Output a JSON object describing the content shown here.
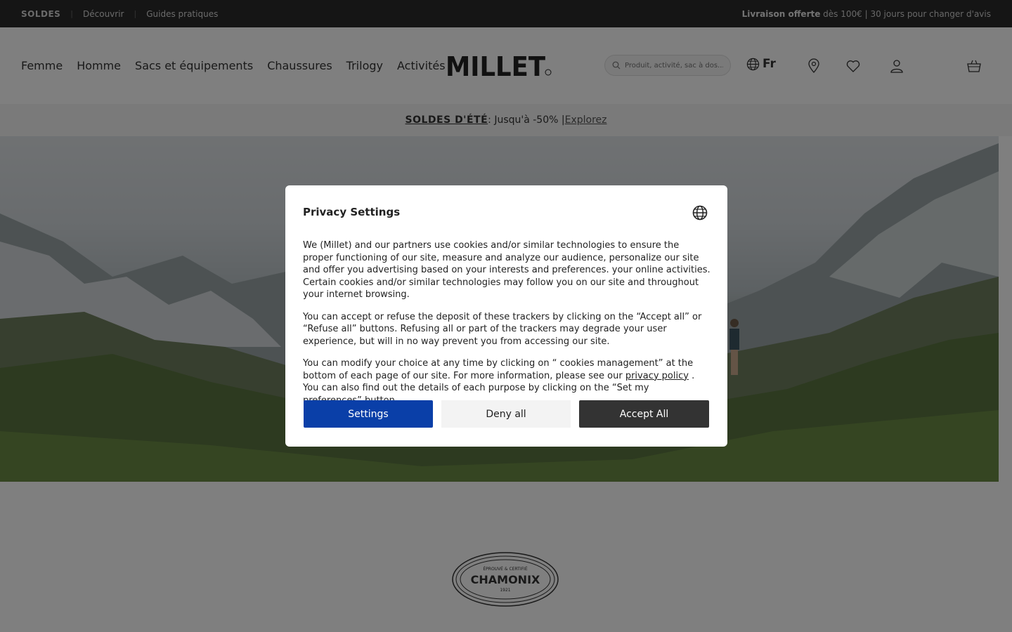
{
  "topbar": {
    "items": [
      "SOLDES",
      "Découvrir",
      "Guides pratiques"
    ],
    "shipping_bold": "Livraison offerte",
    "shipping_rest": " dès 100€ | 30 jours pour changer d'avis"
  },
  "nav": {
    "items": [
      "Femme",
      "Homme",
      "Sacs et équipements",
      "Chaussures",
      "Trilogy",
      "Activités"
    ]
  },
  "logo": {
    "text": "MILLET",
    "icon": "millet-logo"
  },
  "search": {
    "placeholder": "Produit, activité, sac à dos..."
  },
  "language": {
    "label": "Fr",
    "icon": "globe-icon"
  },
  "header_icons": [
    "location-pin-icon",
    "heart-icon",
    "user-icon",
    "basket-icon"
  ],
  "promo": {
    "bold": "SOLDES D'ÉTÉ",
    "text": " : Jusqu'à -50% | ",
    "link": "Explorez"
  },
  "badge": {
    "top": "ÉPROUVÉ & CERTIFIÉ",
    "middle": "CHAMONIX",
    "bottom": "1921"
  },
  "modal": {
    "title": "Privacy Settings",
    "p1": "We (Millet) and our partners use cookies and/or similar technologies to ensure the proper functioning of our site, measure and analyze our audience, personalize our site and offer you advertising based on your interests and preferences. your online activities. Certain cookies and/or similar technologies may follow you on our site and throughout your internet browsing.",
    "p2": "You can accept or refuse the deposit of these trackers by clicking on the “Accept all” or “Refuse all” buttons. Refusing all or part of the trackers may degrade your user experience, but will in no way prevent you from accessing our site.",
    "p3_before": "You can modify your choice at any time by clicking on “ cookies management” at the bottom of each page of our site. For more information, please see our ",
    "p3_link": "privacy policy",
    "p3_after": " . You can also find out the details of each purpose by clicking on the “Set my preferences” button.",
    "buttons": {
      "settings": "Settings",
      "deny": "Deny all",
      "accept": "Accept All"
    },
    "colors": {
      "settings_bg": "#0a3fa8",
      "accept_bg": "#333333",
      "deny_bg": "#f3f3f3"
    }
  }
}
